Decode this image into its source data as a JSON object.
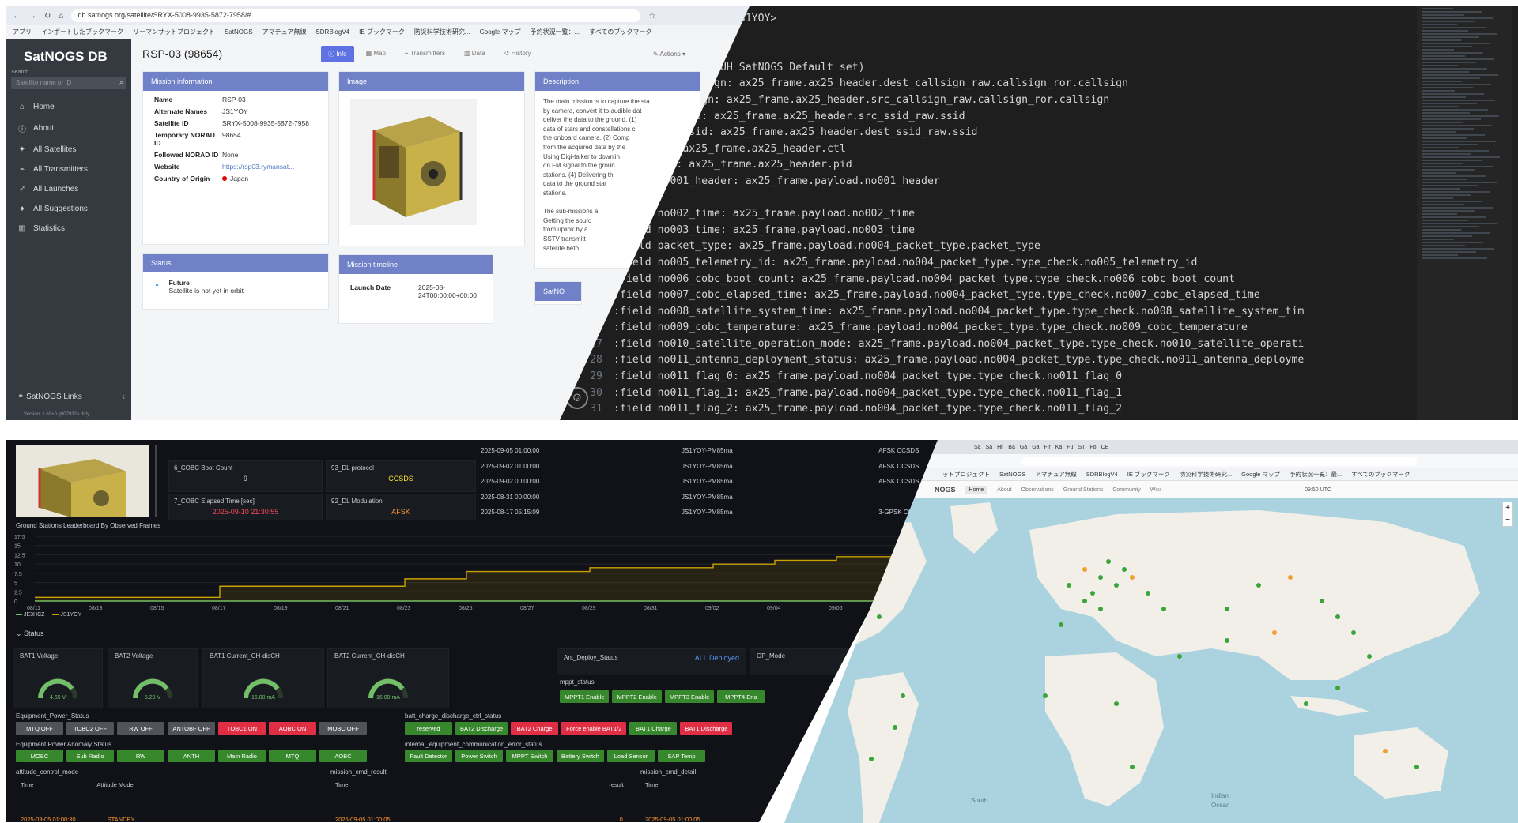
{
  "db": {
    "url": "db.satnogs.org/satellite/SRYX-5008-9935-5872-7958/#",
    "bookmarks": [
      "アプリ",
      "インポートしたブックマーク",
      "リーマンサットプロジェクト",
      "SatNOGS",
      "アマチュア無線",
      "SDRBlogV4",
      "IE ブックマーク",
      "防災科学技術研究...",
      "Google マップ",
      "予約状況一覧：...",
      "すべてのブックマーク"
    ],
    "logo": "SatNOGS DB",
    "search_label": "Search",
    "search_placeholder": "Satellite name or ID",
    "nav": [
      {
        "label": "Home",
        "icon": "home-icon"
      },
      {
        "label": "About",
        "icon": "info-icon"
      },
      {
        "label": "All Satellites",
        "icon": "satellite-icon"
      },
      {
        "label": "All Transmitters",
        "icon": "transmitter-icon"
      },
      {
        "label": "All Launches",
        "icon": "rocket-icon"
      },
      {
        "label": "All Suggestions",
        "icon": "lightbulb-icon"
      },
      {
        "label": "Statistics",
        "icon": "chart-icon"
      }
    ],
    "links_label": "SatNOGS Links",
    "version": "Version: 1.69+0.g907932e.dirty",
    "title": "RSP-03 (98654)",
    "tabs": [
      "Info",
      "Map",
      "Transmitters",
      "Data",
      "History"
    ],
    "actions": "Actions",
    "mission_info": {
      "header": "Mission information",
      "rows": [
        {
          "k": "Name",
          "v": "RSP-03"
        },
        {
          "k": "Alternate Names",
          "v": "JS1YOY"
        },
        {
          "k": "Satellite ID",
          "v": "SRYX-5008-9935-5872-7958"
        },
        {
          "k": "Temporary NORAD ID",
          "v": "98654"
        },
        {
          "k": "Followed NORAD ID",
          "v": "None"
        },
        {
          "k": "Website",
          "v": "https://rsp03.rymansat..."
        },
        {
          "k": "Country of Origin",
          "v": "Japan"
        }
      ]
    },
    "status": {
      "header": "Status",
      "state": "Future",
      "note": "Satellite is not yet in orbit"
    },
    "image_header": "Image",
    "timeline": {
      "header": "Mission timeline",
      "launch_label": "Launch Date",
      "launch_value": "2025-08-24T00:00:00+00:00"
    },
    "description": {
      "header": "Description",
      "text": "The main mission is to capture the sta\nby camera, convert it to audible dat\ndeliver the data to the ground. (1)\ndata of stars and constellations c\nthe onboard camera. (2) Comp\nfrom the acquired data by the\nUsing Digi-talker to downlin\non FM signal to the groun\nstations. (4) Delivering th\ndata to the ground stat\nstations.\n\nThe sub-missions a\nGetting the sourc\nfrom uplink by a\nSSTV transmitt\nsatellite befo"
    },
    "satnogs_card": "SatNO"
  },
  "code": {
    "lines": [
      {
        "n": "",
        "t": "      <czh00361 or JS1YOY>"
      },
      {
        "n": "",
        "t": ""
      },
      {
        "n": "",
        "t": ""
      },
      {
        "n": "",
        "t": "      AX.25(w/G3RUH SatNOGS Default set)"
      },
      {
        "n": "",
        "t": "     dest_callsign: ax25_frame.ax25_header.dest_callsign_raw.callsign_ror.callsign"
      },
      {
        "n": "",
        "t": "eld src_callsign: ax25_frame.ax25_header.src_callsign_raw.callsign_ror.callsign"
      },
      {
        "n": "",
        "t": "field src_ssid: ax25_frame.ax25_header.src_ssid_raw.ssid"
      },
      {
        "n": "",
        "t": "field dest_ssid: ax25_frame.ax25_header.dest_ssid_raw.ssid"
      },
      {
        "n": "",
        "t": "field ctl: ax25_frame.ax25_header.ctl"
      },
      {
        "n": "",
        "t": ":field pid: ax25_frame.ax25_header.pid"
      },
      {
        "n": "",
        "t": ":field no001_header: ax25_frame.payload.no001_header"
      },
      {
        "n": "",
        "t": ""
      },
      {
        "n": "",
        "t": ":field no002_time: ax25_frame.payload.no002_time"
      },
      {
        "n": "",
        "t": ":field no003_time: ax25_frame.payload.no003_time"
      },
      {
        "n": "",
        "t": ":field packet_type: ax25_frame.payload.no004_packet_type.packet_type"
      },
      {
        "n": "2",
        "t": ":field no005_telemetry_id: ax25_frame.payload.no004_packet_type.type_check.no005_telemetry_id"
      },
      {
        "n": "23",
        "t": ":field no006_cobc_boot_count: ax25_frame.payload.no004_packet_type.type_check.no006_cobc_boot_count"
      },
      {
        "n": "24",
        "t": ":field no007_cobc_elapsed_time: ax25_frame.payload.no004_packet_type.type_check.no007_cobc_elapsed_time"
      },
      {
        "n": "25",
        "t": ":field no008_satellite_system_time: ax25_frame.payload.no004_packet_type.type_check.no008_satellite_system_tim"
      },
      {
        "n": "26",
        "t": ":field no009_cobc_temperature: ax25_frame.payload.no004_packet_type.type_check.no009_cobc_temperature"
      },
      {
        "n": "27",
        "t": ":field no010_satellite_operation_mode: ax25_frame.payload.no004_packet_type.type_check.no010_satellite_operati"
      },
      {
        "n": "28",
        "t": ":field no011_antenna_deployment_status: ax25_frame.payload.no004_packet_type.type_check.no011_antenna_deployme"
      },
      {
        "n": "29",
        "t": ":field no011_flag_0: ax25_frame.payload.no004_packet_type.type_check.no011_flag_0"
      },
      {
        "n": "30",
        "t": ":field no011_flag_1: ax25_frame.payload.no004_packet_type.type_check.no011_flag_1"
      },
      {
        "n": "31",
        "t": ":field no011_flag_2: ax25_frame.payload.no004_packet_type.type_check.no011_flag_2"
      }
    ]
  },
  "grafana": {
    "boot_label": "6_COBC Boot Count",
    "boot_value": "9",
    "elapsed_label": "7_COBC Elapsed Time [sec]",
    "elapsed_value": "2025-09-10 21:30:55",
    "dl_protocol_label": "93_DL protocol",
    "dl_protocol_value": "CCSDS",
    "dl_mod_label": "92_DL Modulation",
    "dl_mod_value": "AFSK",
    "table": [
      {
        "time": "2025-09-05 01:00:00",
        "src": "JS1YOY-PM85ma",
        "mode": "AFSK CCSDS"
      },
      {
        "time": "2025-09-02 01:00:00",
        "src": "JS1YOY-PM85ma",
        "mode": "AFSK CCSDS"
      },
      {
        "time": "2025-09-02 00:00:00",
        "src": "JS1YOY-PM85ma",
        "mode": "AFSK CCSDS"
      },
      {
        "time": "2025-08-31 00:00:00",
        "src": "JS1YOY-PM85ma",
        "mode": ""
      },
      {
        "time": "2025-08-17 05:15:09",
        "src": "JS1YOY-PM85ma",
        "mode": "3-GPSK CC"
      }
    ],
    "leaderboard_title": "Ground Stations Leaderboard By Observed Frames",
    "status_section": "Status",
    "gauges": [
      {
        "label": "BAT1 Voltage",
        "value": "4.65 V"
      },
      {
        "label": "BAT2 Voltage",
        "value": "5.28 V"
      },
      {
        "label": "BAT1 Current_CH-disCH",
        "value": "16.00 mA"
      },
      {
        "label": "BAT2 Current_CH-disCH",
        "value": "16.00 mA"
      }
    ],
    "ant_label": "Ant_Deploy_Status",
    "ant_value": "ALL Deployed",
    "op_mode_label": "OP_Mode",
    "mppt_label": "mppt_status",
    "mppt": [
      "MPPT1 Enable",
      "MPPT2 Enable",
      "MPPT3 Enable",
      "MPPT4 Ena"
    ],
    "eq_power_label": "Equipment_Power_Status",
    "eq_power": [
      {
        "t": "MTQ OFF",
        "c": "gr"
      },
      {
        "t": "TOBC2 OFF",
        "c": "gr"
      },
      {
        "t": "RW OFF",
        "c": "gr"
      },
      {
        "t": "ANTOBF OFF",
        "c": "gr"
      },
      {
        "t": "TOBC1 ON",
        "c": "r"
      },
      {
        "t": "AOBC ON",
        "c": "r"
      },
      {
        "t": "MOBC OFF",
        "c": "gr"
      }
    ],
    "batt_label": "batt_charge_discharge_ctrl_status",
    "batt": [
      {
        "t": "reserved",
        "c": "g"
      },
      {
        "t": "BAT2 Discharge",
        "c": "g"
      },
      {
        "t": "BAT2 Charge",
        "c": "r"
      },
      {
        "t": "Force enable BAT1/2",
        "c": "r"
      },
      {
        "t": "BAT1 Charge",
        "c": "g"
      },
      {
        "t": "BAT1 Discharge",
        "c": "r"
      }
    ],
    "anomaly_label": "Equipment Power Anomaly Status",
    "anomaly": [
      "MOBC",
      "Sub Radio",
      "RW",
      "ANTH",
      "Main Radio",
      "MTQ",
      "AOBC"
    ],
    "comm_err_label": "internal_equipment_communication_error_status",
    "comm_err": [
      "Fault Detector",
      "Power Switch",
      "MPPT Switch",
      "Battery Switch",
      "Load Sensor",
      "SAP Temp"
    ],
    "attitude_label": "attitude_control_mode",
    "attitude_cols": [
      "Time",
      "Attitude Mode"
    ],
    "attitude_row": [
      "2025-09-05 01:00:30",
      "STANDBY"
    ],
    "cmd_result_label": "mission_cmd_result",
    "cmd_result_cols": [
      "Time",
      "result"
    ],
    "cmd_result_row": [
      "2025-09-05 01:00:05",
      "0"
    ],
    "cmd_detail_label": "mission_cmd_detail",
    "cmd_detail_cols": [
      "Time"
    ],
    "cmd_detail_row": [
      "2025-09-05 01:00:05"
    ],
    "legend": [
      "JE3HCZ",
      "JS1YOY"
    ],
    "colors": {
      "series1": "#73bf69",
      "series2": "#c9a100"
    }
  },
  "chart_data": {
    "type": "line",
    "title": "Ground Stations Leaderboard By Observed Frames",
    "categories": [
      "08/11",
      "08/13",
      "08/15",
      "08/17",
      "08/19",
      "08/21",
      "08/23",
      "08/25",
      "08/27",
      "08/29",
      "08/31",
      "09/02",
      "09/04",
      "09/06",
      "09/08"
    ],
    "ylim": [
      0,
      17.5
    ],
    "yticks": [
      "17.5",
      "15",
      "12.5",
      "10",
      "7.5",
      "5",
      "2.5",
      "0"
    ],
    "series": [
      {
        "name": "JE3HCZ",
        "values": [
          0,
          0,
          0,
          0,
          0,
          0,
          0,
          0,
          0,
          0,
          0,
          0,
          0,
          0,
          0
        ]
      },
      {
        "name": "JS1YOY",
        "values": [
          1,
          1,
          1,
          4,
          4,
          4,
          6,
          8,
          8,
          9,
          9,
          10,
          11,
          12,
          12
        ]
      }
    ],
    "legend": "bottom-left",
    "grid": true
  },
  "map": {
    "tabs": [
      "Sa",
      "Sa",
      "Hil",
      "Ba",
      "Ga",
      "Ga",
      "Fir",
      "Ka",
      "Fu",
      "ST",
      "Fo",
      "CE"
    ],
    "bookmarks": [
      "ットプロジェクト",
      "SatNOGS",
      "アマチュア無線",
      "SDRBlogV4",
      "IE ブックマーク",
      "防災科学技術研究...",
      "Google マップ",
      "予約状況一覧：最...",
      "すべてのブックマーク"
    ],
    "brand": "NOGS",
    "nav": [
      "Home",
      "About",
      "Observations",
      "Ground Stations",
      "Community",
      "Wiki"
    ],
    "utc": "09:50 UTC",
    "labels": [
      {
        "t": "South",
        "pos": "south"
      },
      {
        "t": "Indian",
        "pos": "indian"
      },
      {
        "t": "Ocean",
        "pos": "ocean"
      }
    ]
  }
}
